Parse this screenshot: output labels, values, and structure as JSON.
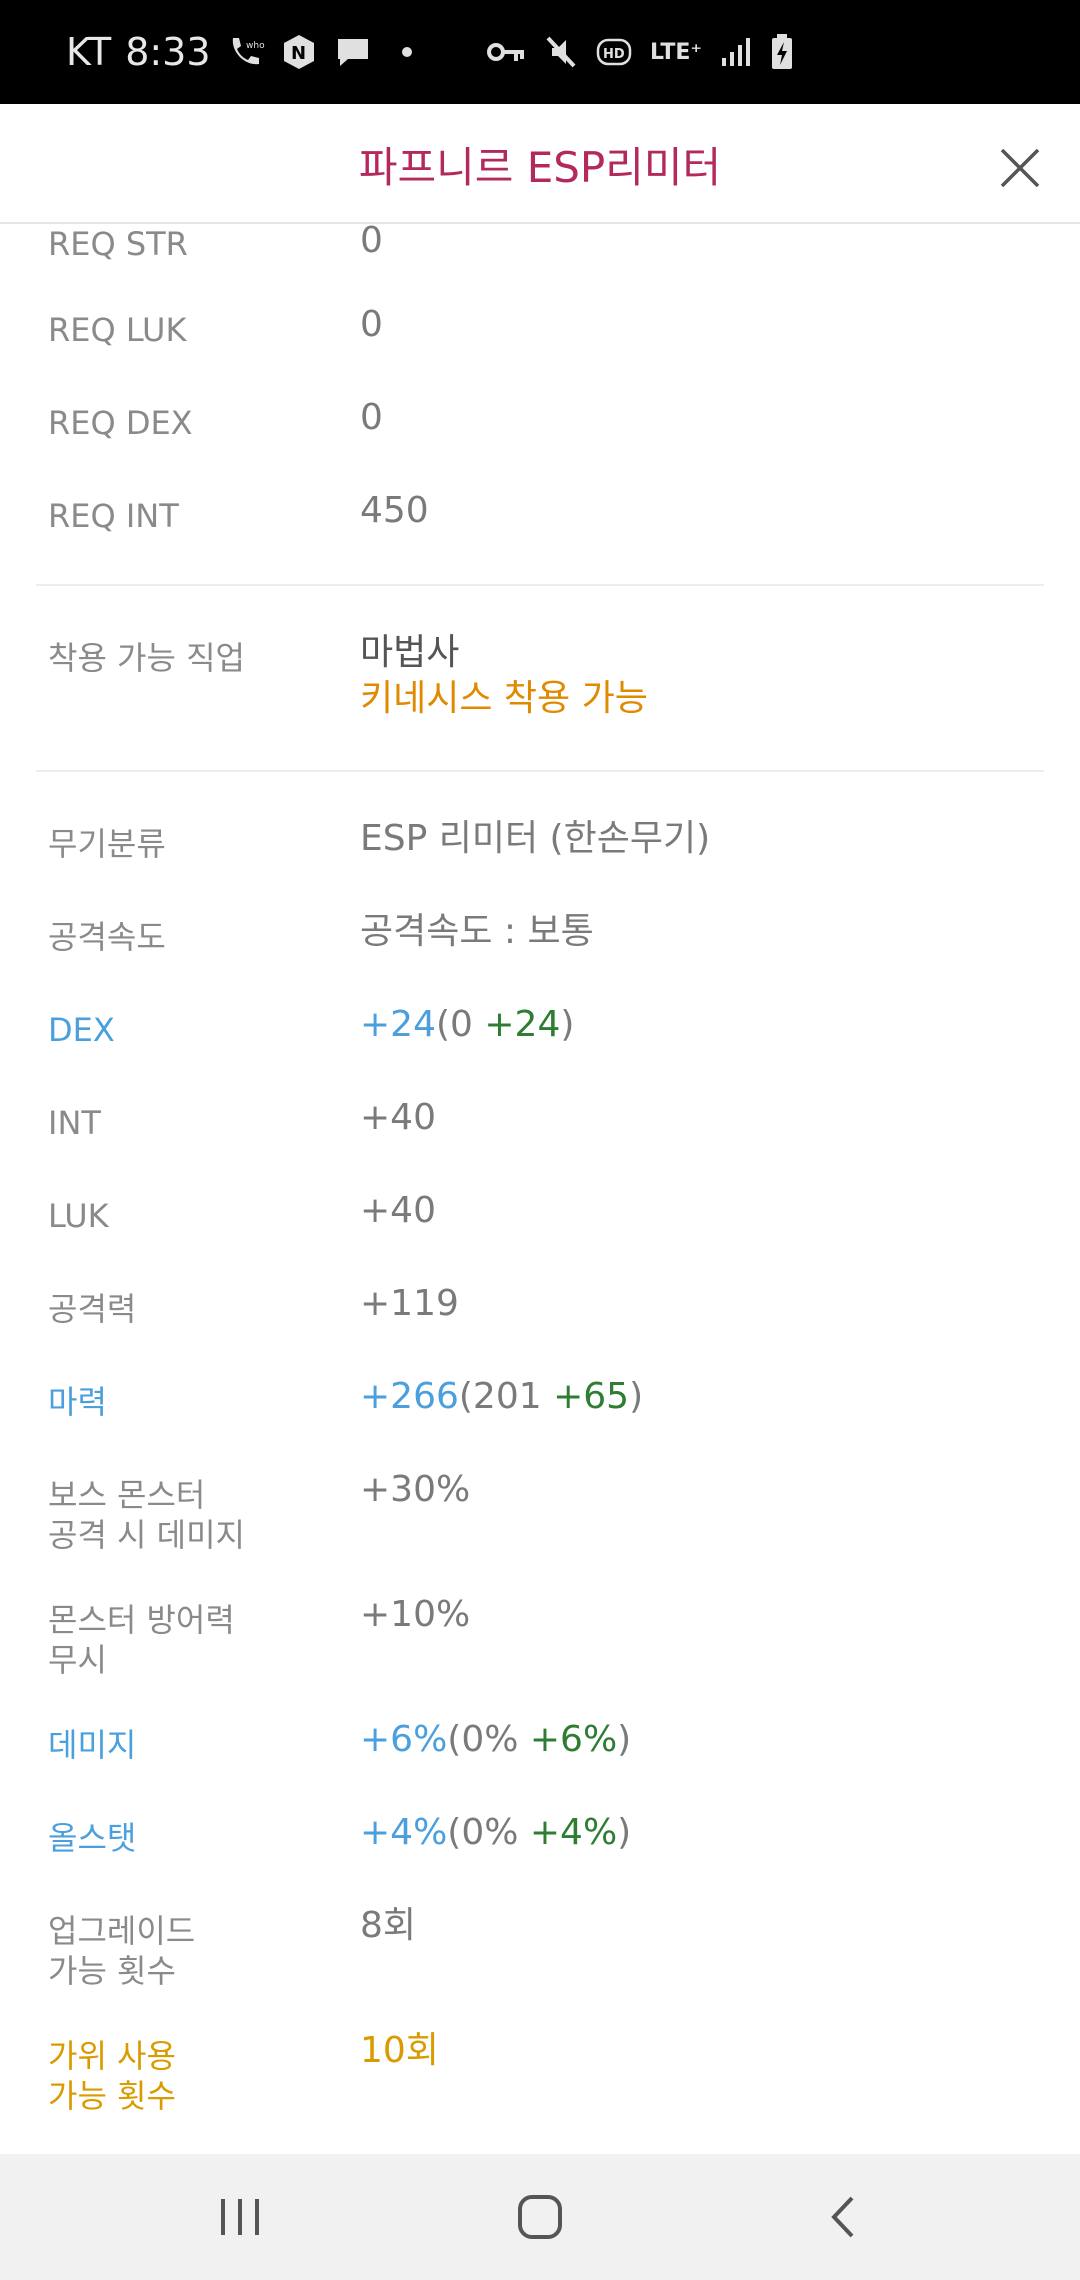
{
  "status_bar": {
    "carrier": "KT",
    "time": "8:33",
    "icons_left": [
      "who-call-icon",
      "n-notification-icon",
      "chat-bubble-icon",
      "dot-icon"
    ],
    "icons_right": [
      "vpn-key-icon",
      "mute-icon",
      "hd-icon",
      "lte-plus-icon",
      "signal-icon",
      "battery-charging-icon"
    ],
    "lte_label": "LTE⁺",
    "hd_label": "HD"
  },
  "header": {
    "title": "파프니르 ESP리미터",
    "title_color": "#b3295e",
    "close_icon": "close-icon"
  },
  "requirements": [
    {
      "label": "REQ STR",
      "value": "0"
    },
    {
      "label": "REQ LUK",
      "value": "0"
    },
    {
      "label": "REQ DEX",
      "value": "0"
    },
    {
      "label": "REQ INT",
      "value": "450"
    }
  ],
  "job": {
    "label": "착용 가능 직업",
    "value": "마법사",
    "note": "키네시스 착용 가능"
  },
  "stats": {
    "weapon_type": {
      "label": "무기분류",
      "value": "ESP 리미터 (한손무기)"
    },
    "attack_speed": {
      "label": "공격속도",
      "value": "공격속도 : 보통"
    },
    "dex": {
      "label": "DEX",
      "total": "+24",
      "open": "(0 ",
      "bonus": "+24",
      "close": ")"
    },
    "int": {
      "label": "INT",
      "value": "+40"
    },
    "luk": {
      "label": "LUK",
      "value": "+40"
    },
    "attack": {
      "label": "공격력",
      "value": "+119"
    },
    "magic": {
      "label": "마력",
      "total": "+266",
      "open": "(201 ",
      "bonus": "+65",
      "close": ")"
    },
    "boss_damage": {
      "label_line1": "보스 몬스터",
      "label_line2": "공격 시 데미지",
      "value": "+30%"
    },
    "ignore_def": {
      "label_line1": "몬스터 방어력",
      "label_line2": "무시",
      "value": "+10%"
    },
    "damage": {
      "label": "데미지",
      "total": "+6%",
      "open": "(0% ",
      "bonus": "+6%",
      "close": ")"
    },
    "all_stat": {
      "label": "올스탯",
      "total": "+4%",
      "open": "(0% ",
      "bonus": "+4%",
      "close": ")"
    },
    "upgrades": {
      "label_line1": "업그레이드",
      "label_line2": "가능 횟수",
      "value": "8회"
    },
    "scissors": {
      "label_line1": "가위 사용",
      "label_line2": "가능 횟수",
      "value": "10회"
    }
  },
  "colors": {
    "accent_blue": "#4a9fdc",
    "bonus_green": "#2e7d32",
    "kinesis_orange": "#e08a00",
    "scissors_gold": "#d99b00"
  },
  "nav_bar": {
    "icons": [
      "recent-apps-icon",
      "home-icon",
      "back-icon"
    ]
  }
}
